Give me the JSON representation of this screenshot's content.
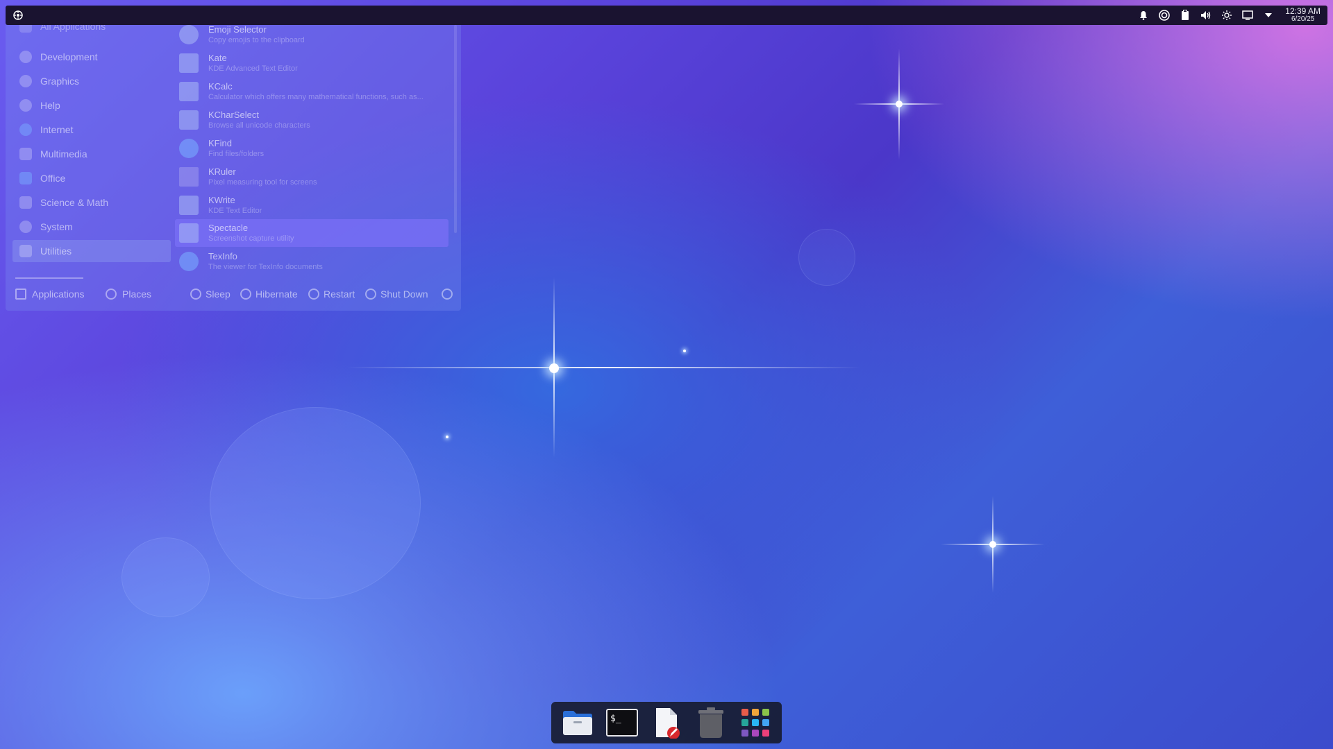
{
  "top_panel": {
    "clock_time": "12:39 AM",
    "clock_date": "6/20/25",
    "icons": [
      "app-menu-icon",
      "notifications-icon",
      "updates-icon",
      "clipboard-icon",
      "volume-icon",
      "brightness-icon",
      "display-icon",
      "tray-expand-icon"
    ]
  },
  "app_menu": {
    "categories": [
      {
        "label": "All Applications"
      },
      {
        "label": "Development"
      },
      {
        "label": "Graphics"
      },
      {
        "label": "Help"
      },
      {
        "label": "Internet"
      },
      {
        "label": "Multimedia"
      },
      {
        "label": "Office"
      },
      {
        "label": "Science & Math"
      },
      {
        "label": "System"
      },
      {
        "label": "Utilities"
      }
    ],
    "selected_category": "Utilities",
    "apps": [
      {
        "name": "Emoji Selector",
        "desc": "Copy emojis to the clipboard"
      },
      {
        "name": "Kate",
        "desc": "KDE Advanced Text Editor"
      },
      {
        "name": "KCalc",
        "desc": "Calculator which offers many mathematical functions, such as..."
      },
      {
        "name": "KCharSelect",
        "desc": "Browse all unicode characters"
      },
      {
        "name": "KFind",
        "desc": "Find files/folders"
      },
      {
        "name": "KRuler",
        "desc": "Pixel measuring tool for screens"
      },
      {
        "name": "KWrite",
        "desc": "KDE Text Editor"
      },
      {
        "name": "Spectacle",
        "desc": "Screenshot capture utility"
      },
      {
        "name": "TexInfo",
        "desc": "The viewer for TexInfo documents"
      }
    ],
    "selected_app": "Spectacle",
    "tabs": {
      "applications": "Applications",
      "places": "Places"
    },
    "power": {
      "sleep": "Sleep",
      "hibernate": "Hibernate",
      "restart": "Restart",
      "shutdown": "Shut Down"
    }
  },
  "dock": {
    "items": [
      "file-manager-icon",
      "terminal-icon",
      "text-editor-icon",
      "trash-icon",
      "app-grid-icon"
    ]
  },
  "colors": {
    "panel_bg": "#1a1330",
    "accent": "#7a6ef5",
    "dock_bg": "#14182a"
  }
}
